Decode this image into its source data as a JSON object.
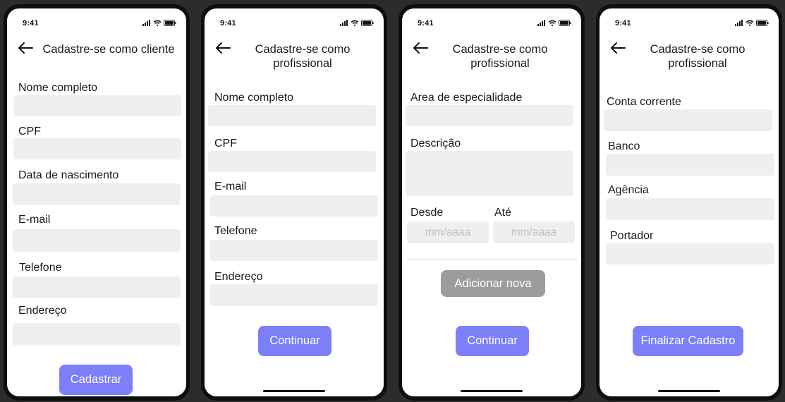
{
  "status_time": "9:41",
  "screens": [
    {
      "title": "Cadastre-se como cliente",
      "fields": [
        "Nome completo",
        "CPF",
        "Data de nascimento",
        "E-mail",
        "Telefone",
        "Endereço"
      ],
      "button": "Cadastrar"
    },
    {
      "title": "Cadastre-se como profissional",
      "fields": [
        "Nome completo",
        "CPF",
        "E-mail",
        "Telefone",
        "Endereço"
      ],
      "button": "Continuar"
    },
    {
      "title": "Cadastre-se como profissional",
      "fields": [
        "Area de especialidade",
        "Descrição"
      ],
      "date_from_label": "Desde",
      "date_to_label": "Até",
      "date_placeholder": "mm/aaaa",
      "add_button": "Adicionar nova",
      "button": "Continuar"
    },
    {
      "title": "Cadastre-se como profissional",
      "fields": [
        "Conta corrente",
        "Banco",
        "Agência",
        "Portador"
      ],
      "button": "Finalizar Cadastro"
    }
  ],
  "colors": {
    "primary_button": "#7d7ff8",
    "secondary_button": "#9a9c9e",
    "field_background": "#efefef",
    "background": "#2c2c2c"
  },
  "icons": [
    "back-arrow-icon",
    "signal-icon",
    "wifi-icon",
    "battery-icon"
  ]
}
